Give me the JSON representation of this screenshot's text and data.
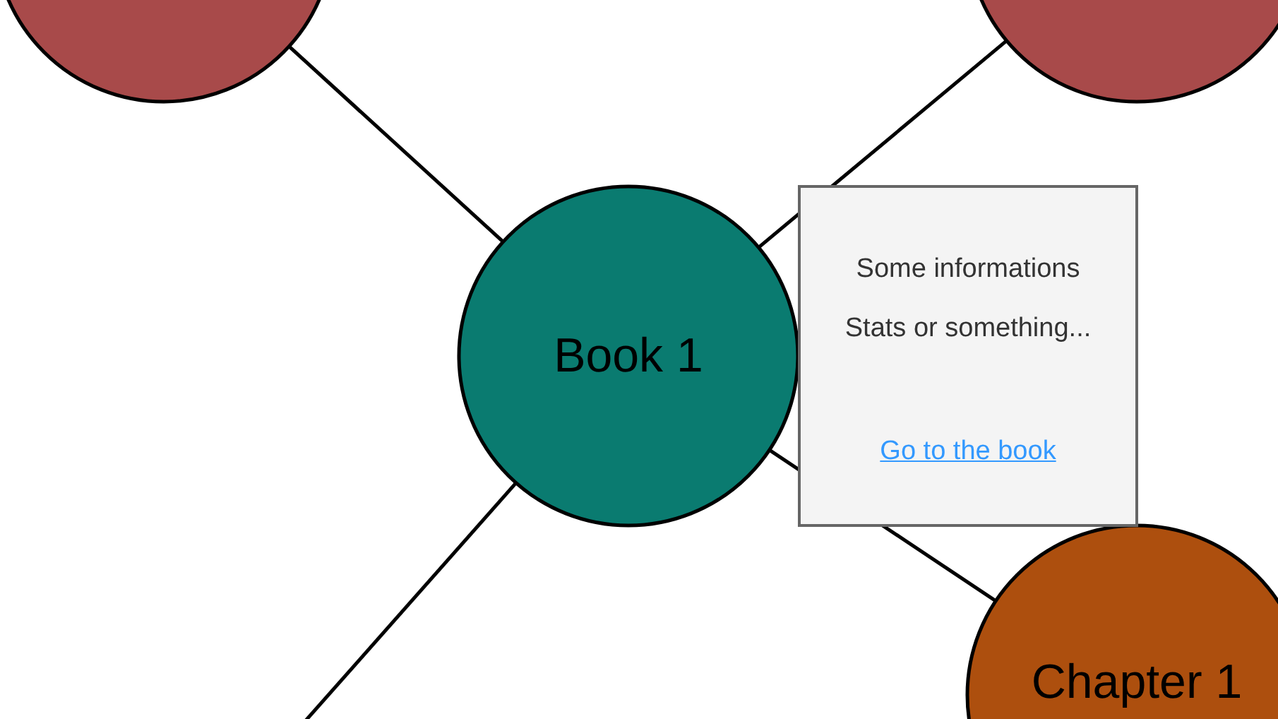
{
  "nodes": [
    {
      "color": "#a84a4a"
    },
    {
      "color": "#a84a4a"
    },
    {
      "label": "Book 1",
      "color": "#0a7b70"
    },
    {
      "label": "Chapter 1",
      "color": "#ad4f0e"
    }
  ],
  "popup": {
    "lines": [
      "Some informations",
      "Stats or something..."
    ],
    "link": "Go to the book"
  }
}
